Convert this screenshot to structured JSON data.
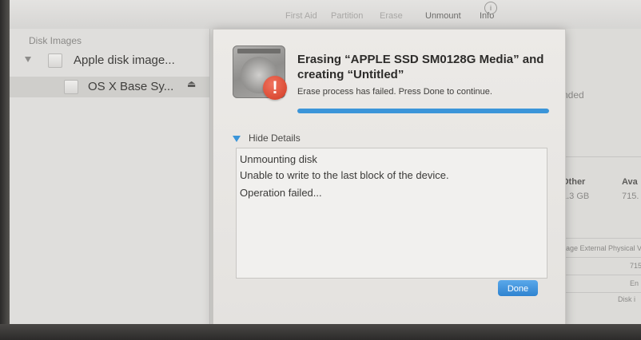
{
  "toolbar": {
    "items": [
      {
        "label": "First Aid",
        "state": "disabled"
      },
      {
        "label": "Partition",
        "state": "disabled"
      },
      {
        "label": "Erase",
        "state": "disabled"
      },
      {
        "label": "Unmount",
        "state": "enabled"
      },
      {
        "label": "Info",
        "state": "enabled"
      }
    ],
    "info_icon": "info-icon"
  },
  "sidebar": {
    "header": "Disk Images",
    "items": [
      {
        "label": "Apple disk image...",
        "expanded": true,
        "icon": "disk-icon"
      },
      {
        "label": "OS X Base Sy...",
        "selected": true,
        "icon": "disk-icon",
        "eject_icon": "eject-icon"
      }
    ]
  },
  "background": {
    "type_text": "xtended",
    "other_label": "Other",
    "other_value": "1.3 GB",
    "avail_label": "Ava",
    "avail_value": "715.",
    "info_rows": [
      "nage External Physical V",
      "715",
      "En",
      "Disk i"
    ]
  },
  "sheet": {
    "title": "Erasing “APPLE SSD SM0128G Media” and creating “Untitled”",
    "message": "Erase process has failed. Press Done to continue.",
    "progress_percent": 100,
    "details_toggle": "Hide Details",
    "log_lines": [
      "Unmounting disk",
      "Unable to write to the last block of the device.",
      "Operation failed..."
    ],
    "done_label": "Done",
    "colors": {
      "accent": "#3b95d9",
      "alert": "#d23a22"
    }
  }
}
